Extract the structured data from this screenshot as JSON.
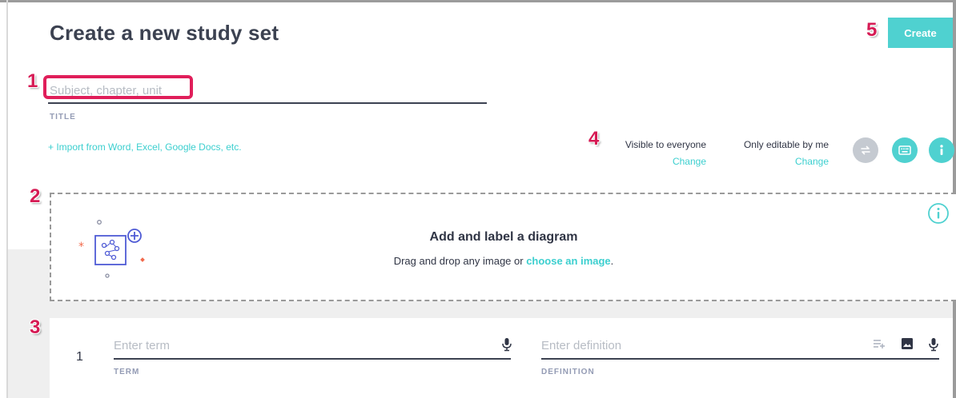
{
  "page": {
    "title": "Create a new study set",
    "create_label": "Create"
  },
  "callouts": [
    "1",
    "2",
    "3",
    "4",
    "5"
  ],
  "title_field": {
    "placeholder": "Subject, chapter, unit",
    "label": "TITLE"
  },
  "import_link": "+ Import from Word, Excel, Google Docs, etc.",
  "visibility": {
    "visible_text": "Visible to everyone",
    "visible_change": "Change",
    "editable_text": "Only editable by me",
    "editable_change": "Change"
  },
  "toolbar_icons": [
    "swap-icon",
    "keyboard-icon",
    "info-icon"
  ],
  "diagram": {
    "title": "Add and label a diagram",
    "subtitle_prefix": "Drag and drop any image or ",
    "subtitle_link": "choose an image",
    "subtitle_suffix": "."
  },
  "card": {
    "number": "1",
    "term_placeholder": "Enter term",
    "term_label": "TERM",
    "definition_placeholder": "Enter definition",
    "definition_label": "DEFINITION"
  },
  "colors": {
    "accent": "#4fd1d0",
    "link": "#3ccfcf",
    "callout": "#d61a54",
    "dark_text": "#303545",
    "muted_label": "#939bb4"
  }
}
